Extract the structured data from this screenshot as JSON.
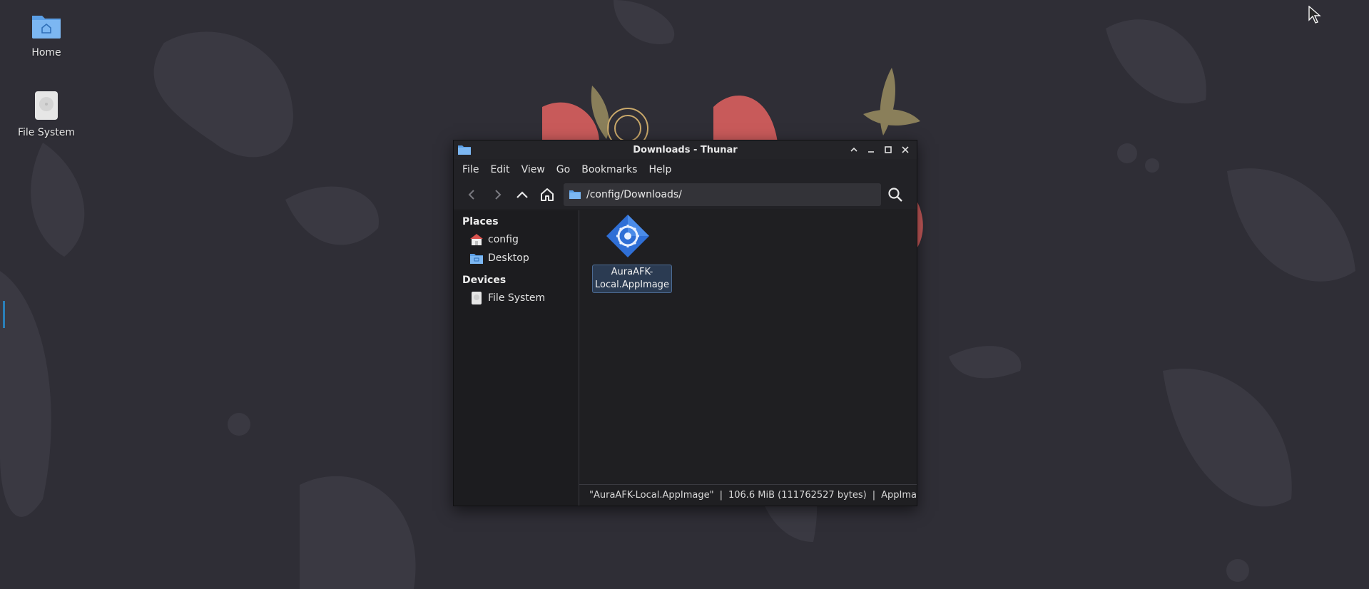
{
  "desktop": {
    "icons": [
      {
        "label": "Home",
        "icon": "home-folder-icon"
      },
      {
        "label": "File System",
        "icon": "drive-icon"
      }
    ]
  },
  "window": {
    "title": "Downloads - Thunar",
    "menu": [
      "File",
      "Edit",
      "View",
      "Go",
      "Bookmarks",
      "Help"
    ],
    "location_path": "/config/Downloads/",
    "sidebar": {
      "places_heading": "Places",
      "places": [
        {
          "label": "config",
          "icon": "home-icon"
        },
        {
          "label": "Desktop",
          "icon": "desktop-folder-icon"
        }
      ],
      "devices_heading": "Devices",
      "devices": [
        {
          "label": "File System",
          "icon": "drive-icon"
        }
      ]
    },
    "files": [
      {
        "name": "AuraAFK-Local.AppImage",
        "icon": "appimage-icon",
        "selected": true
      }
    ],
    "status": {
      "name": "\"AuraAFK-Local.AppImage\"",
      "size": "106.6 MiB (111762527 bytes)",
      "type": "AppImage ap...",
      "separator": "|"
    }
  },
  "colors": {
    "accent": "#2a7fb8",
    "selection": "#2b3b52",
    "wallpaper": "#2f2e36"
  }
}
